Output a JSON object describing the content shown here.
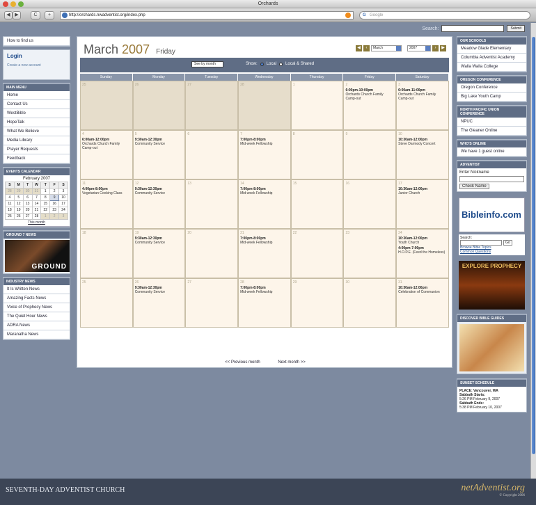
{
  "window": {
    "title": "Orchards"
  },
  "browser": {
    "url": "http://orchards.nwadventist.org/index.php",
    "search_placeholder": "Google",
    "back": "◀",
    "forward": "▶",
    "reload": "C",
    "add": "+"
  },
  "site_search": {
    "label": "Search:",
    "button": "Submit"
  },
  "left": {
    "find_us": "How to find us",
    "login": {
      "title": "Login",
      "create": "Create a new account"
    },
    "main_menu": {
      "title": "MAIN MENU",
      "items": [
        "Home",
        "Contact Us",
        "WestBible",
        "HopeTalk",
        "What We Believe",
        "Media Library",
        "Prayer Requests",
        "Feedback"
      ]
    },
    "events": {
      "title": "EVENTS CALENDAR",
      "month": "February 2007",
      "days": [
        "S",
        "M",
        "T",
        "W",
        "T",
        "F",
        "S"
      ],
      "weeks": [
        [
          "28",
          "29",
          "30",
          "31",
          "1",
          "2",
          "3"
        ],
        [
          "4",
          "5",
          "6",
          "7",
          "8",
          "9",
          "10"
        ],
        [
          "11",
          "12",
          "13",
          "14",
          "15",
          "16",
          "17"
        ],
        [
          "18",
          "19",
          "20",
          "21",
          "22",
          "23",
          "24"
        ],
        [
          "25",
          "26",
          "27",
          "28",
          "1",
          "2",
          "3"
        ]
      ],
      "all": "This month"
    },
    "ground": {
      "title": "GROUND 7 NEWS",
      "label": "GROUND"
    },
    "industry": {
      "title": "INDUSTRY NEWS",
      "items": [
        "It Is Written News",
        "Amazing Facts News",
        "Voice of Prophecy News",
        "The Quiet Hour News",
        "ADRA News",
        "Maranatha News"
      ]
    }
  },
  "calendar": {
    "month": "March",
    "year": "2007",
    "weekday": "Friday",
    "month_select": "March",
    "year_select": "2007",
    "view": "See by month",
    "show_label": "Show:",
    "opt_local": "Local",
    "opt_local_shared": "Local & Shared",
    "days": [
      "Sunday",
      "Monday",
      "Tuesday",
      "Wednesday",
      "Thursday",
      "Friday",
      "Saturday"
    ],
    "weeks": [
      [
        {
          "d": "25",
          "p": true
        },
        {
          "d": "26",
          "p": true
        },
        {
          "d": "27",
          "p": true
        },
        {
          "d": "28",
          "p": true
        },
        {
          "d": "1"
        },
        {
          "d": "2",
          "t": "6:00pm-10:00pm",
          "e": "Orchards Church Family Camp-out"
        },
        {
          "d": "3",
          "t": "6:00am-11:00pm",
          "e": "Orchards Church Family Camp-out"
        }
      ],
      [
        {
          "d": "4",
          "t": "6:00am-12:00pm",
          "e": "Orchards Church Family Camp-out"
        },
        {
          "d": "5",
          "t": "9:30am-12:30pm",
          "e": "Community Service"
        },
        {
          "d": "6"
        },
        {
          "d": "7",
          "t": "7:00pm-8:00pm",
          "e": "Mid-week Fellowship"
        },
        {
          "d": "8"
        },
        {
          "d": "9"
        },
        {
          "d": "10",
          "t": "10:30am-12:00pm",
          "e": "Steve Darmody Concert"
        }
      ],
      [
        {
          "d": "11",
          "t": "4:00pm-8:00pm",
          "e": "Vegetarian Cooking Class"
        },
        {
          "d": "12",
          "t": "9:30am-12:30pm",
          "e": "Community Service"
        },
        {
          "d": "13"
        },
        {
          "d": "14",
          "t": "7:00pm-8:00pm",
          "e": "Mid-week Fellowship"
        },
        {
          "d": "15"
        },
        {
          "d": "16"
        },
        {
          "d": "17",
          "t": "10:30am-12:00pm",
          "e": "Junior Church"
        }
      ],
      [
        {
          "d": "18"
        },
        {
          "d": "19",
          "t": "9:30am-12:30pm",
          "e": "Community Service"
        },
        {
          "d": "20"
        },
        {
          "d": "21",
          "t": "7:00pm-8:00pm",
          "e": "Mid-week Fellowship"
        },
        {
          "d": "22"
        },
        {
          "d": "23"
        },
        {
          "d": "24",
          "t": "10:30am-12:00pm",
          "e": "Youth Church",
          "t2": "4:00pm-7:00pm",
          "e2": "H.O.P.E. (Feed the Homeless)"
        }
      ],
      [
        {
          "d": "25"
        },
        {
          "d": "26",
          "t": "9:30am-12:30pm",
          "e": "Community Service"
        },
        {
          "d": "27"
        },
        {
          "d": "28",
          "t": "7:00pm-8:00pm",
          "e": "Mid-week Fellowship"
        },
        {
          "d": "29"
        },
        {
          "d": "30"
        },
        {
          "d": "31",
          "t": "10:30am-12:00pm",
          "e": "Celebration of Communion"
        }
      ]
    ],
    "prev": "<< Previous month",
    "next": "Next month >>"
  },
  "right": {
    "schools": {
      "title": "OUR SCHOOLS",
      "items": [
        "Meadow Glade Elementary",
        "Columbia Adventist Academy",
        "Walla Walla College"
      ]
    },
    "conference": {
      "title": "OREGON CONFERENCE",
      "items": [
        "Oregon Conference",
        "Big Lake Youth Camp"
      ]
    },
    "union": {
      "title": "NORTH PACIFIC UNION CONFERENCE",
      "items": [
        "NPUC",
        "The Gleaner Online"
      ]
    },
    "online": {
      "title": "WHO'S ONLINE",
      "text": "We have 1 guest online"
    },
    "adventist": {
      "title": "ADVENTIST",
      "label": "Enter Nickname",
      "button": "Check Name"
    },
    "bible": {
      "logo": "Bibleinfo.com",
      "search": "Search:",
      "go": "Go",
      "link1": "Browse Bible Topics",
      "link2": "Common Questions"
    },
    "prophecy": {
      "text": "EXPLORE PROPHECY"
    },
    "guides": {
      "title": "DISCOVER BIBLE GUIDES"
    },
    "sunset": {
      "title": "SUNSET SCHEDULE",
      "place": "PLACE: Vancouver, WA",
      "starts": "Sabbath Starts:",
      "starts_val": "5:26 PM February 9, 2007",
      "ends": "Sabbath Ends:",
      "ends_val": "5:38 PM February 10, 2007"
    }
  },
  "footer": {
    "left": "SEVENTH-DAY ADVENTIST CHURCH",
    "right": "netAdventist.org",
    "right_sub": "© Copyright 2006"
  }
}
